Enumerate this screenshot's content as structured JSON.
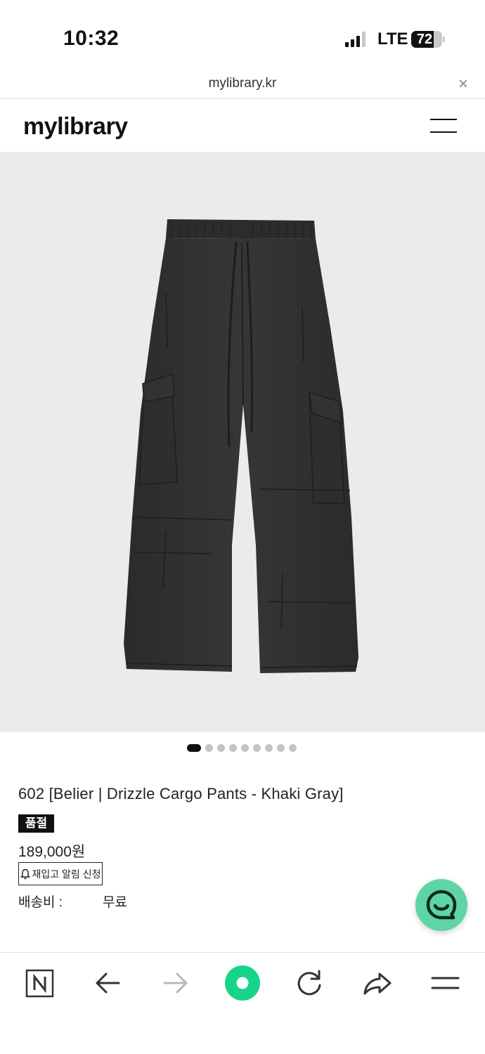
{
  "status": {
    "time": "10:32",
    "network": "LTE",
    "battery": "72",
    "battery_level": 0.72
  },
  "browser": {
    "url": "mylibrary.kr",
    "close_symbol": "×"
  },
  "site": {
    "logo": "mylibrary"
  },
  "carousel": {
    "total": 9,
    "active_index": 0
  },
  "product": {
    "title": "602 [Belier | Drizzle Cargo Pants - Khaki Gray]",
    "soldout_badge": "품절",
    "price": "189,000원",
    "restock_button": "재입고 알림 신청",
    "shipping_label": "배송비 :",
    "shipping_value": "무료"
  },
  "icons": {
    "restock": "bell-icon",
    "chat": "chat-smile-icon",
    "toolbar": [
      "naver-n-icon",
      "back-arrow-icon",
      "forward-arrow-icon",
      "home-green-icon",
      "reload-icon",
      "share-icon",
      "menu-icon"
    ]
  },
  "colors": {
    "accent_green": "#1ec800",
    "chat_green": "#5fd5a5",
    "image_bg": "#ebebeb",
    "product": "#2e2f2e"
  }
}
